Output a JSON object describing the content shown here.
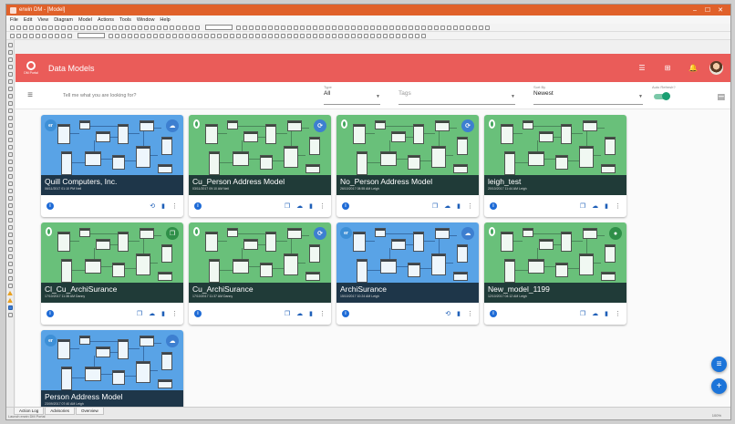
{
  "window": {
    "title": "erwin DM - [Model]",
    "controls": [
      "–",
      "☐",
      "✕"
    ]
  },
  "menubar": [
    "File",
    "Edit",
    "View",
    "Diagram",
    "Model",
    "Actions",
    "Tools",
    "Window",
    "Help"
  ],
  "appbar": {
    "title": "Data Models",
    "logo_text": "DM Portal"
  },
  "search": {
    "placeholder": "Tell me what you are looking for?",
    "type_label": "Type",
    "type_value": "All",
    "tags_label": "Tags",
    "sort_label": "Sort By",
    "sort_value": "Newest",
    "auto_refresh_label": "Auto Refresh?",
    "auto_refresh_on": true
  },
  "cards": [
    {
      "name": "Quill Computers, Inc.",
      "subtitle": "06/11/2017 01:10 PM Neil",
      "theme": "blue",
      "corner_icon": "cloud-icon"
    },
    {
      "name": "Cu_Person Address Model",
      "subtitle": "03/11/2017 09:10 AM Neil",
      "theme": "green",
      "corner_icon": "sync-icon"
    },
    {
      "name": "No_Person Address Model",
      "subtitle": "26/10/2017 08:55 AM Leigh",
      "theme": "green",
      "corner_icon": "sync-icon"
    },
    {
      "name": "leigh_test",
      "subtitle": "20/10/2017 11:44 AM Leigh",
      "theme": "green",
      "corner_icon": ""
    },
    {
      "name": "Cl_Cu_ArchiSurance",
      "subtitle": "17/10/2017 11:38 AM Danny",
      "theme": "green",
      "corner_icon": "copy-icon"
    },
    {
      "name": "Cu_ArchiSurance",
      "subtitle": "17/10/2017 11:37 AM Danny",
      "theme": "green",
      "corner_icon": "sync-icon"
    },
    {
      "name": "ArchiSurance",
      "subtitle": "15/10/2017 10:24 AM Leigh",
      "theme": "blue",
      "corner_icon": "cloud-icon"
    },
    {
      "name": "New_model_1199",
      "subtitle": "12/10/2017 04:12 AM Leigh",
      "theme": "green",
      "corner_icon": "user-icon"
    },
    {
      "name": "Person Address Model",
      "subtitle": "23/09/2017 07:40 AM Leigh",
      "theme": "blue",
      "corner_icon": "cloud-icon"
    }
  ],
  "bottom_tabs": [
    "Action Log",
    "Advisories",
    "Overview"
  ],
  "status_text": "Launch erwin DM Portal",
  "zoom": "100%"
}
